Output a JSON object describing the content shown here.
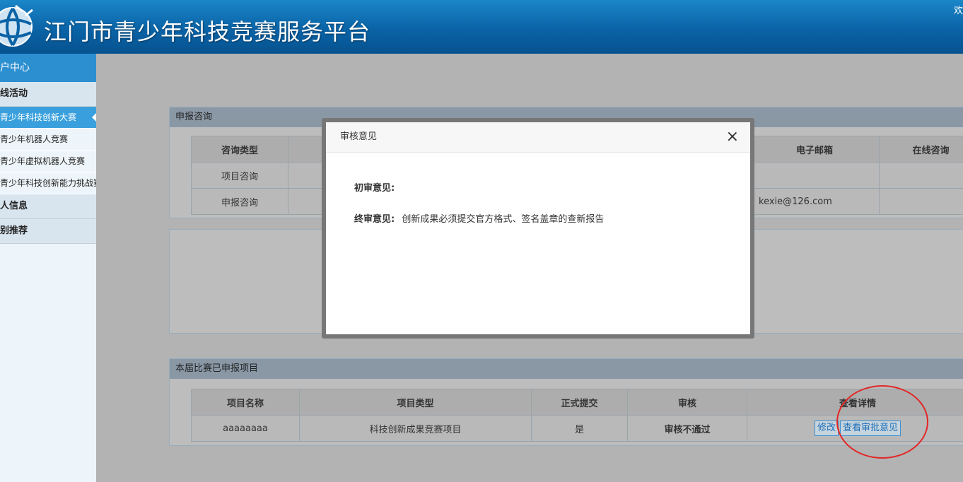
{
  "header": {
    "title": "江门市青少年科技竞赛服务平台",
    "welcome": "欢"
  },
  "sidebar": {
    "head": "户中心",
    "groups": [
      {
        "label": "线活动"
      },
      {
        "label": "人信息"
      },
      {
        "label": "别推荐"
      }
    ],
    "items": [
      {
        "label": "青少年科技创新大赛",
        "active": true
      },
      {
        "label": "青少年机器人竞赛"
      },
      {
        "label": "青少年虚拟机器人竞赛"
      },
      {
        "label": "青少年科技创新能力挑战赛"
      }
    ]
  },
  "consult": {
    "title": "申报咨询",
    "headers": [
      "咨询类型",
      "",
      "电子邮箱",
      "在线咨询"
    ],
    "rows": [
      [
        "项目咨询",
        "",
        "",
        ""
      ],
      [
        "申报咨询",
        "",
        "kexie@126.com",
        ""
      ]
    ]
  },
  "projects": {
    "title": "本届比赛已申报项目",
    "headers": [
      "项目名称",
      "项目类型",
      "正式提交",
      "审核",
      "查看详情"
    ],
    "row": {
      "name": "aaaaaaaa",
      "type": "科技创新成果竞赛项目",
      "submitted": "是",
      "review": "审核不通过",
      "edit_label": "修改",
      "view_label": "查看审批意见"
    }
  },
  "modal": {
    "title": "审核意见",
    "close_icon": "×",
    "first_label": "初审意见:",
    "first_value": "",
    "final_label": "终审意见:",
    "final_value": "创新成果必须提交官方格式、签名盖章的查新报告"
  },
  "colors": {
    "header_blue": "#0a63a6",
    "sidebar_active": "#3aa0dd",
    "fail_red": "#b00000",
    "annotation_red": "#e32626"
  }
}
